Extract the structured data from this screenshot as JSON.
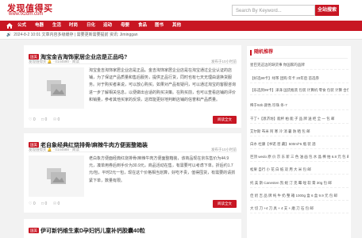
{
  "header": {
    "logo_title": "发现值得买",
    "logo_url": "www.fxzdm.com",
    "search_placeholder": "Search By Keyword...",
    "search_button": "全站搜索"
  },
  "nav": {
    "items": [
      "公式",
      "电器",
      "生活",
      "时尚",
      "日化",
      "运动",
      "母婴",
      "食品",
      "图书",
      "其他"
    ]
  },
  "ticker": {
    "date": "2024-8-2 10:01",
    "text": "文章内容多级缓存 | 需要更新需要提前 资讯: Jiminggan"
  },
  "posts": [
    {
      "tag": "国美",
      "title": "淘宝金吉淘饰家居企业店是正品吗?",
      "meta_left": "发现值得买 🔔 · 0144590 · 阅读",
      "meta_right": "发布于10小时前",
      "excerpt": "淘宝金吉淘饰家居企业店是正品。金吉淘饰家居企业店是在淘宝通过企业认证的店铺，为了保证产品质量和售后服务，提供正品行货，同时也有七天无理由退换货服务。对于购买者来说，可以放心购买。如果对产品有疑问，可以通过淘宝的客服咨询进一步了解相关信息，以便做出合适的购买决策。在购买前，也可以查看店铺的评价和销量，参考其他买家的反馈，这样能更好地判断店铺的信誉和产品质量。",
      "likes": "0",
      "comments": "0",
      "views": "0",
      "readmore": "阅读全文"
    },
    {
      "tag": "国美",
      "title": "老自象经典红烧排骨/麻辣牛肉方便面整箱装",
      "meta_left": "发现值得买 🔔 · 0144588 · 阅读",
      "meta_right": "发布于10小时前",
      "excerpt": "老白象方便面经典红烧排骨/麻辣牛肉方便面整箱装，该商品现在京东售价为44.9元，凑单用券后到手价为30.9元，商品活动在售，有需要可以考虑下单。折后约1.7元/包，平时2元一包，现在这个价格相当划算，好吃不贵，值得囤货，有需要的请抓紧下单，数量有限。",
      "likes": "0",
      "comments": "0",
      "views": "0",
      "readmore": "阅读全文"
    },
    {
      "tag": "国美",
      "title": "伊可新钙维生素D孕妇钙儿童补钙胶囊40粒",
      "meta_left": "",
      "meta_right": ""
    }
  ],
  "sidebar": {
    "heading": "随机推荐",
    "items": [
      "星巴克这边的缺货事 你国家的品牌",
      "【好选99卡】绿茶 团购 年卡 20年后 首选券",
      "【乐选到99卡】泽泽 国货瓶装 包装 计算机 零食 包装 计算 合包 28元",
      "稀于92b 颜色 珍珠 条-7",
      "千丁+【恩济坊】能杯 柏 能 子 品 牌 送 柜 全 一 包 邮",
      "艾尔斯 布米 阿 寒 冷 消 暑 防 晒 包 邮",
      "白水 杜康【书诺 窖 藏】500ml*6 瓶 装 酒",
      "巨顶 wedo 原 价 京 东 新 三 色 油 画 包 水 晶 棒 拍 6.8 元 包 邮",
      "松果 自行 小 花 白 纸 双 用 大 米 包 邮",
      "托 美 斯 Canesten 凯 妮 汀 克 霉 唑 软 膏 30g 包 邮",
      "佳 奶 吉 品 牌 纯 牛 奶 整 箱 1000g 盒 6 盒 9.9 元 包 邮",
      "大 切 刀 +4 刀 具 + 4 支 + 磨 刀 石 包 邮"
    ]
  },
  "colors": {
    "brand": "#c81623"
  }
}
